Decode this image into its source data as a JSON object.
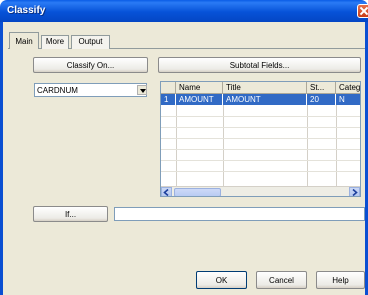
{
  "window": {
    "title": "Classify"
  },
  "tabs": [
    {
      "label": "Main",
      "active": true
    },
    {
      "label": "More",
      "active": false
    },
    {
      "label": "Output",
      "active": false
    }
  ],
  "buttons": {
    "classify_on": "Classify On...",
    "subtotal_fields": "Subtotal Fields...",
    "if": "If...",
    "ok": "OK",
    "cancel": "Cancel",
    "help": "Help"
  },
  "classify_field": {
    "selected": "CARDNUM"
  },
  "grid": {
    "columns": [
      "",
      "Name",
      "Title",
      "St...",
      "Categ"
    ],
    "rows": [
      {
        "num": "1",
        "name": "AMOUNT",
        "title": "AMOUNT",
        "st": "20",
        "categ": "N",
        "selected": true
      }
    ]
  },
  "if_expression": {
    "value": ""
  },
  "icons": [
    "close-icon",
    "chevron-down-icon",
    "arrow-left-icon",
    "arrow-right-icon"
  ],
  "colors": {
    "titlebar": "#0a5ce6",
    "selection": "#316ac5",
    "face": "#ece9d8"
  }
}
